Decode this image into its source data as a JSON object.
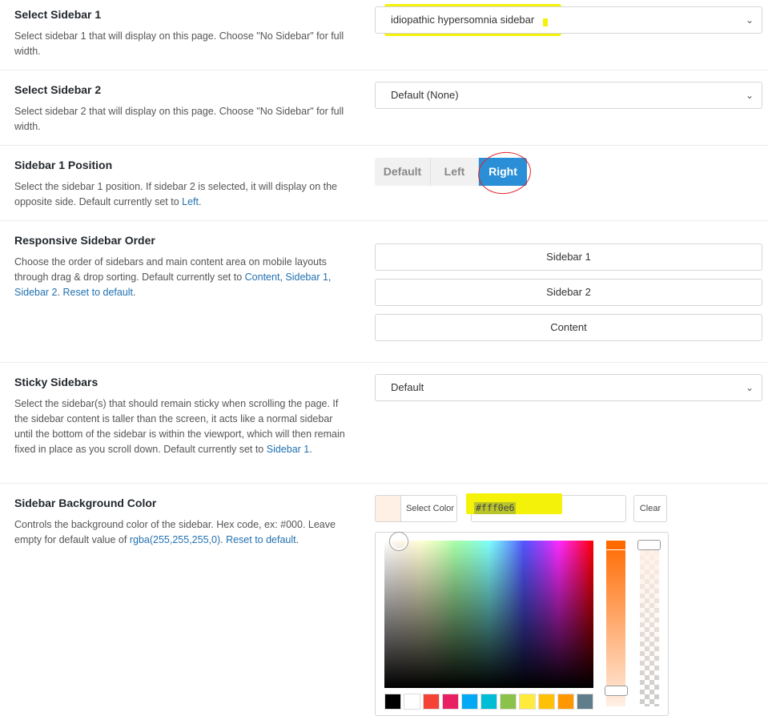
{
  "sidebar1": {
    "label": "Select Sidebar 1",
    "desc": "Select sidebar 1 that will display on this page. Choose \"No Sidebar\" for full width.",
    "value": "idiopathic hypersomnia sidebar"
  },
  "sidebar2": {
    "label": "Select Sidebar 2",
    "desc": "Select sidebar 2 that will display on this page. Choose \"No Sidebar\" for full width.",
    "value": "Default (None)"
  },
  "position": {
    "label": "Sidebar 1 Position",
    "desc_pre": "Select the sidebar 1 position. If sidebar 2 is selected, it will display on the opposite side. Default currently set to ",
    "desc_link": "Left",
    "desc_post": ".",
    "options": [
      "Default",
      "Left",
      "Right"
    ],
    "selected": "Right"
  },
  "order": {
    "label": "Responsive Sidebar Order",
    "desc_pre": "Choose the order of sidebars and main content area on mobile layouts through drag & drop sorting. Default currently set to ",
    "link1": "Content",
    "sep1": ", ",
    "link2": "Sidebar 1",
    "sep2": ", ",
    "link3": "Sidebar 2",
    "sep3": ". ",
    "link4": "Reset to default",
    "end": ".",
    "items": [
      "Sidebar 1",
      "Sidebar 2",
      "Content"
    ]
  },
  "sticky": {
    "label": "Sticky Sidebars",
    "desc_pre": "Select the sidebar(s) that should remain sticky when scrolling the page. If the sidebar content is taller than the screen, it acts like a normal sidebar until the bottom of the sidebar is within the viewport, which will then remain fixed in place as you scroll down. Default currently set to ",
    "desc_link": "Sidebar 1",
    "desc_post": ".",
    "value": "Default"
  },
  "bgcolor": {
    "label": "Sidebar Background Color",
    "desc_pre": "Controls the background color of the sidebar. Hex code, ex: #000. Leave empty for default value of ",
    "link1": "rgba(255,255,255,0)",
    "sep": ". ",
    "link2": "Reset to default",
    "end": ".",
    "select_label": "Select Color",
    "hex_value": "#fff0e6",
    "clear_label": "Clear",
    "swatch_color": "#fff0e6",
    "palette": [
      "#000000",
      "#ffffff",
      "#f44336",
      "#e91e63",
      "#03a9f4",
      "#00bcd4",
      "#8bc34a",
      "#ffeb3b",
      "#ffc107",
      "#ff9800",
      "#607d8b"
    ]
  }
}
